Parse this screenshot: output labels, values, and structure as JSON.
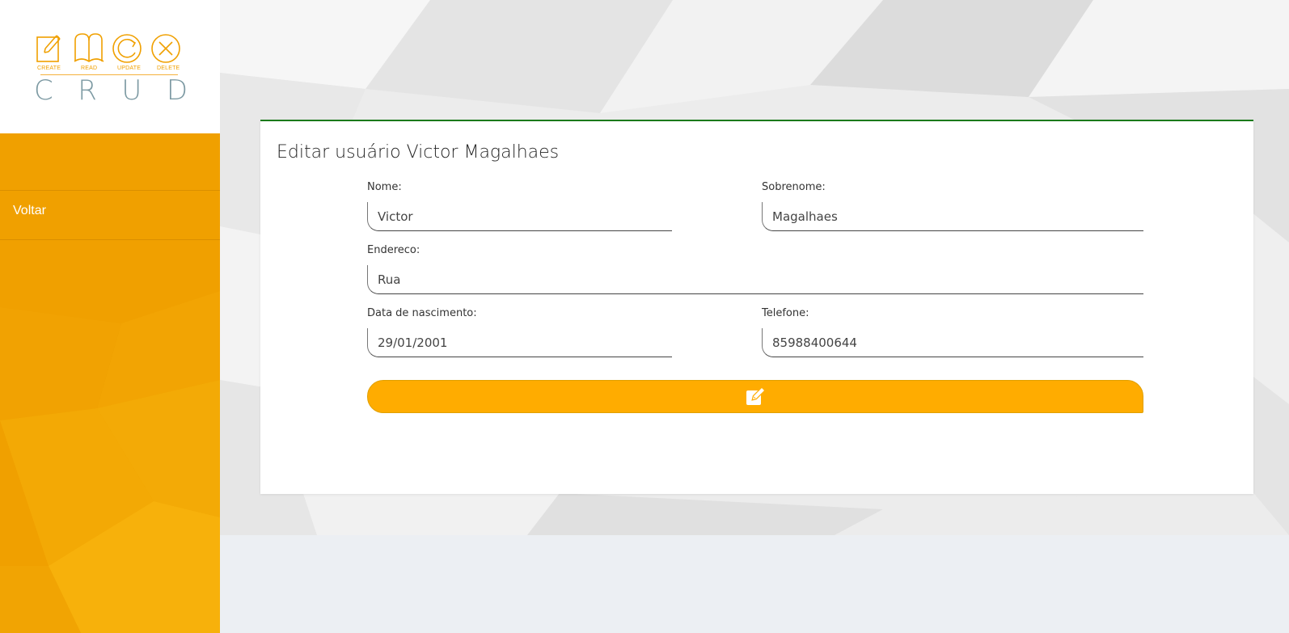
{
  "logo": {
    "captions": [
      "CREATE",
      "READ",
      "UPDATE",
      "DELETE"
    ],
    "letters": [
      "C",
      "R",
      "U",
      "D"
    ]
  },
  "sidebar": {
    "items": [
      {
        "label": "Voltar"
      }
    ]
  },
  "form": {
    "title": "Editar usuário Victor Magalhaes",
    "fields": {
      "nome": {
        "label": "Nome:",
        "value": "Victor"
      },
      "sobrenome": {
        "label": "Sobrenome:",
        "value": "Magalhaes"
      },
      "endereco": {
        "label": "Endereco:",
        "value": "Rua"
      },
      "nascimento": {
        "label": "Data de nascimento:",
        "value": "29/01/2001"
      },
      "telefone": {
        "label": "Telefone:",
        "value": "85988400644"
      }
    },
    "submit_icon": "edit-icon"
  },
  "colors": {
    "sidebar": "#f0a000",
    "button": "#ffac00",
    "card_border": "#1a7a1a",
    "logo_text": "#7d9aa3"
  }
}
